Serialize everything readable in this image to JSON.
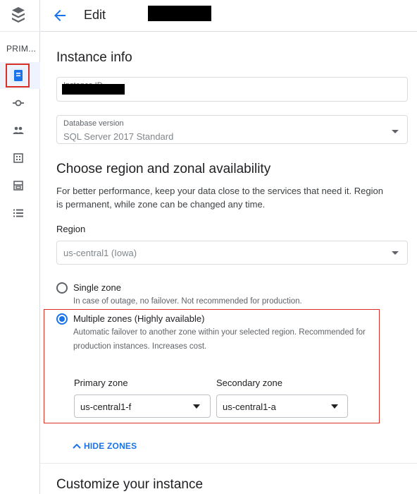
{
  "header": {
    "title": "Edit"
  },
  "rail": {
    "section_label": "PRIM...",
    "items": [
      "overview-icon",
      "connections-icon",
      "users-icon",
      "databases-icon",
      "backups-icon",
      "operations-icon"
    ]
  },
  "instance_info": {
    "heading": "Instance info",
    "instance_id_label": "Instance ID",
    "db_version_label": "Database version",
    "db_version_value": "SQL Server 2017 Standard"
  },
  "region_section": {
    "heading": "Choose region and zonal availability",
    "description": "For better performance, keep your data close to the services that need it. Region is permanent, while zone can be changed any time.",
    "region_label": "Region",
    "region_value": "us-central1 (Iowa)"
  },
  "zonal": {
    "single_zone": {
      "title": "Single zone",
      "description": "In case of outage, no failover. Not recommended for production.",
      "selected": false
    },
    "multiple_zones": {
      "title": "Multiple zones (Highly available)",
      "description": "Automatic failover to another zone within your selected region. Recommended for production instances. Increases cost.",
      "selected": true
    },
    "primary_zone_label": "Primary zone",
    "primary_zone_value": "us-central1-f",
    "secondary_zone_label": "Secondary zone",
    "secondary_zone_value": "us-central1-a",
    "hide_zones_label": "HIDE ZONES"
  },
  "customize": {
    "heading": "Customize your instance"
  },
  "colors": {
    "accent": "#1a73e8",
    "highlight": "#d93025"
  }
}
